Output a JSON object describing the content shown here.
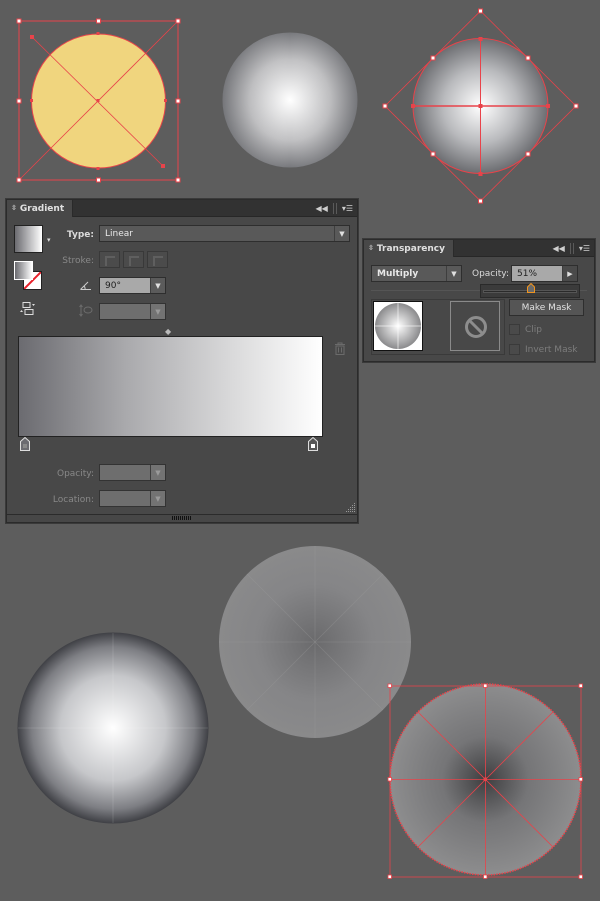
{
  "canvas": {
    "background": "#5d5d5d",
    "selection_color": "#e8434a",
    "yellow_fill": "#f0d57e"
  },
  "gradient_panel": {
    "title": "Gradient",
    "type_label": "Type:",
    "type_value": "Linear",
    "stroke_label": "Stroke:",
    "angle_value": "90°",
    "aspect_value": "",
    "opacity_label": "Opacity:",
    "opacity_value": "",
    "location_label": "Location:",
    "location_value": "",
    "gradient_stops": [
      {
        "color": "#6b6b70",
        "location_pct": 0
      },
      {
        "color": "#ffffff",
        "location_pct": 100
      }
    ],
    "icons": {
      "collapse": "double-chevron-left-icon",
      "menu": "panel-menu-icon",
      "angle": "angle-icon",
      "aspect": "aspect-ratio-icon",
      "delete": "trash-icon",
      "reverse": "reverse-gradient-icon"
    }
  },
  "transparency_panel": {
    "title": "Transparency",
    "blend_mode": "Multiply",
    "opacity_label": "Opacity:",
    "opacity_value": "51%",
    "opacity_slider_fraction": 0.51,
    "make_mask_label": "Make Mask",
    "clip_label": "Clip",
    "invert_mask_label": "Invert Mask",
    "clip_checked": false,
    "invert_mask_checked": false
  }
}
